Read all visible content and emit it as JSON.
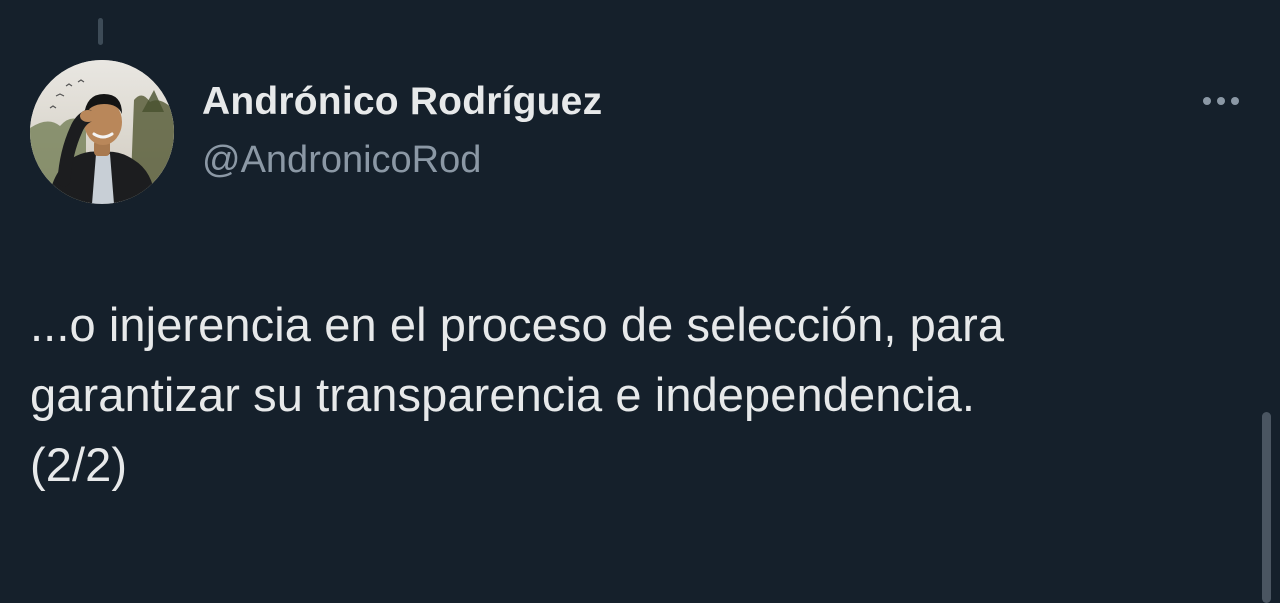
{
  "author": {
    "display_name": "Andrónico Rodríguez",
    "handle": "@AndronicoRod",
    "avatar_icon": "profile-photo"
  },
  "tweet": {
    "text": "...o injerencia en el proceso de selección, para\ngarantizar su transparencia e independencia.\n(2/2)"
  },
  "toolbar": {
    "more_icon": "more-horizontal-icon"
  },
  "colors": {
    "background": "#15202b",
    "primary_text": "#e7e9ea",
    "secondary_text": "#8b98a5",
    "thread_line": "#3d4b57"
  }
}
